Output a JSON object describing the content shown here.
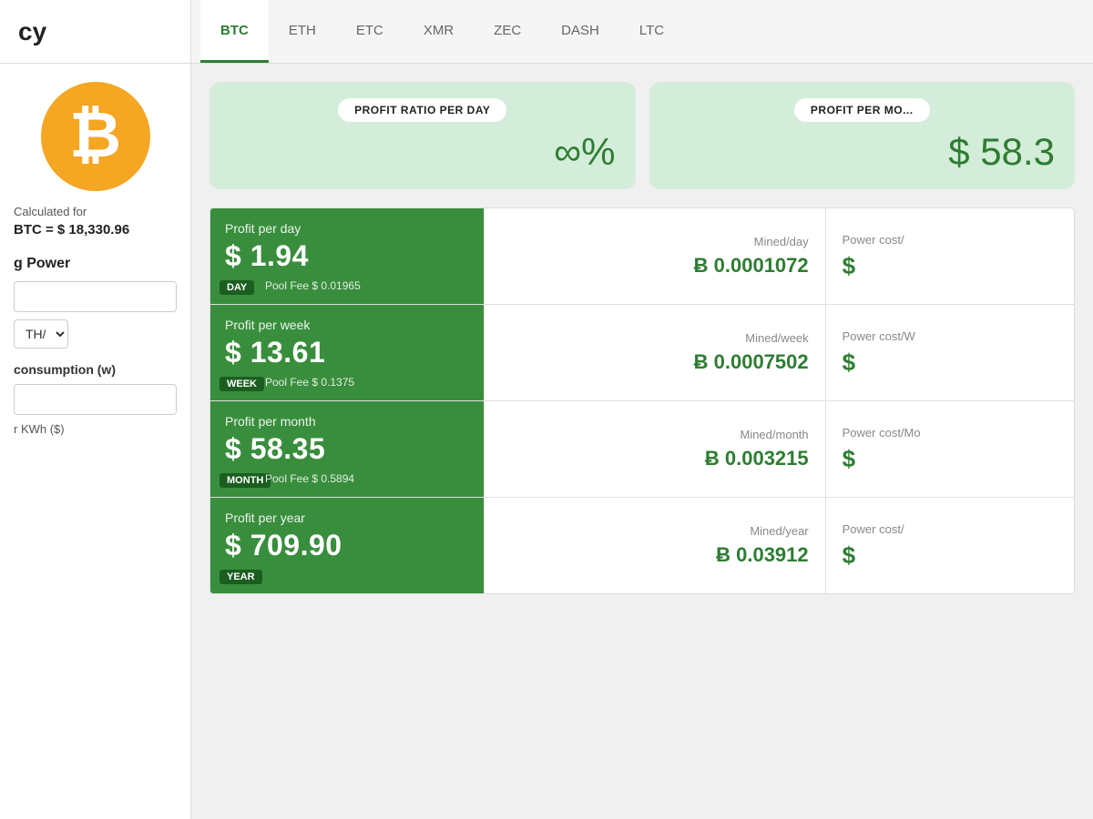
{
  "app": {
    "title": "cy"
  },
  "nav": {
    "tabs": [
      {
        "id": "btc",
        "label": "BTC",
        "active": true
      },
      {
        "id": "eth",
        "label": "ETH",
        "active": false
      },
      {
        "id": "etc",
        "label": "ETC",
        "active": false
      },
      {
        "id": "xmr",
        "label": "XMR",
        "active": false
      },
      {
        "id": "zec",
        "label": "ZEC",
        "active": false
      },
      {
        "id": "dash",
        "label": "DASH",
        "active": false
      },
      {
        "id": "ltc",
        "label": "LTC",
        "active": false
      }
    ]
  },
  "sidebar": {
    "calc_for_label": "Calculated for",
    "btc_price": "BTC = $ 18,330.96",
    "hashing_power_label": "g Power",
    "consumption_label": "consumption (w)",
    "kwh_label": "r KWh ($)",
    "select_placeholder": "v"
  },
  "summary": {
    "card1": {
      "label": "PROFIT RATIO PER DAY",
      "value": "∞%"
    },
    "card2": {
      "label": "PROFIT PER MO...",
      "value": "$ 58.3"
    }
  },
  "rows": [
    {
      "period": "Day",
      "profit_title": "Profit per day",
      "profit_value": "$ 1.94",
      "pool_fee": "Pool Fee $ 0.01965",
      "mined_label": "Mined/day",
      "mined_value": "Ƀ 0.0001072",
      "power_label": "Power cost/",
      "power_value": "$"
    },
    {
      "period": "Week",
      "profit_title": "Profit per week",
      "profit_value": "$ 13.61",
      "pool_fee": "Pool Fee $ 0.1375",
      "mined_label": "Mined/week",
      "mined_value": "Ƀ 0.0007502",
      "power_label": "Power cost/W",
      "power_value": "$"
    },
    {
      "period": "Month",
      "profit_title": "Profit per month",
      "profit_value": "$ 58.35",
      "pool_fee": "Pool Fee $ 0.5894",
      "mined_label": "Mined/month",
      "mined_value": "Ƀ 0.003215",
      "power_label": "Power cost/Mo",
      "power_value": "$"
    },
    {
      "period": "Year",
      "profit_title": "Profit per year",
      "profit_value": "$ 709.90",
      "pool_fee": "",
      "mined_label": "Mined/year",
      "mined_value": "Ƀ 0.03912",
      "power_label": "Power cost/",
      "power_value": "$"
    }
  ],
  "colors": {
    "green_dark": "#2e7d32",
    "green_medium": "#388e3c",
    "green_bg": "#d4edda",
    "orange": "#f5a623"
  }
}
